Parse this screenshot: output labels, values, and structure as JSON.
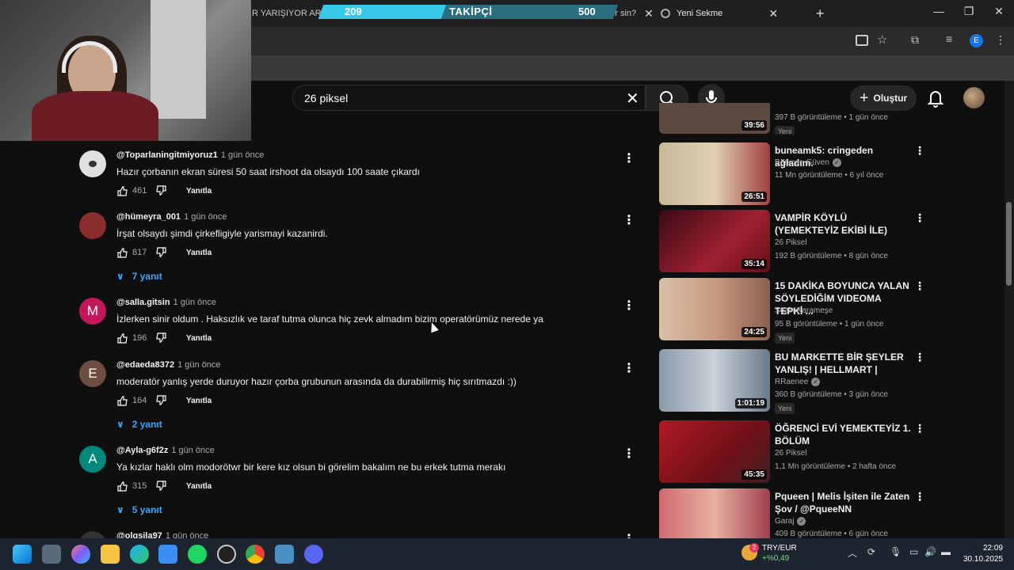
{
  "browser": {
    "tabs": [
      {
        "title": "R YARIŞIYOR AREN",
        "close": "✕"
      },
      {
        "title": "(283) Hangisini Te... Eder sin?",
        "close": "✕"
      },
      {
        "title": "Yeni Sekme",
        "close": "✕"
      }
    ],
    "new_tab": "+",
    "profile_initial": "E"
  },
  "overlay": {
    "follower_current": "209",
    "follower_label": "TAKİPÇİ",
    "follower_goal": "500",
    "follower_progress": 0.418
  },
  "header": {
    "search_query": "26 piksel",
    "create_label": "Oluştur"
  },
  "comments": [
    {
      "author": "@Toparlaningitmiyoruz1",
      "time": "1 gün önce",
      "text": "Hazır çorbanın ekran süresi 50 saat irshoot da olsaydı 100 saate çıkardı",
      "likes": "461",
      "reply": "Yanıtla",
      "avatar": "",
      "avatar_color": "#e0e0e0"
    },
    {
      "author": "@hümeyra_001",
      "time": "1 gün önce",
      "text": "İrşat olsaydı şimdi çirkefligiyle yarismayi kazanirdi.",
      "likes": "817",
      "reply": "Yanıtla",
      "avatar": "",
      "avatar_color": "#8a2d2d",
      "replies": "7 yanıt"
    },
    {
      "author": "@salla.gitsin",
      "time": "1 gün önce",
      "text": "İzlerken sinir oldum . Haksızlık ve taraf tutma olunca hiç zevk almadım bizim operatörümüz nerede ya",
      "likes": "196",
      "reply": "Yanıtla",
      "avatar": "M",
      "avatar_color": "#c2185b"
    },
    {
      "author": "@edaeda8372",
      "time": "1 gün önce",
      "text": "moderatör yanlış yerde duruyor hazır çorba grubunun arasında da durabilirmiş hiç sırıtmazdı :))",
      "likes": "164",
      "reply": "Yanıtla",
      "avatar": "E",
      "avatar_color": "#6d4c41",
      "replies": "2 yanıt"
    },
    {
      "author": "@Ayla-g6f2z",
      "time": "1 gün önce",
      "text": "Ya kızlar haklı olm modorötwr bir kere kız olsun bi görelim bakalım ne bu erkek tutma merakı",
      "likes": "315",
      "reply": "Yanıtla",
      "avatar": "A",
      "avatar_color": "#00897b",
      "replies": "5 yanıt"
    },
    {
      "author": "@olgsila97",
      "time": "1 gün önce",
      "text": "",
      "likes": "",
      "reply": "",
      "avatar": "",
      "avatar_color": "#333"
    }
  ],
  "recommendations": [
    {
      "title": "",
      "channel": "",
      "meta": "397 B görüntüleme • 1 gün önce",
      "duration": "39:56",
      "badge": "Yeni",
      "thumb_color": "#5a4a40"
    },
    {
      "title": "buneamk5: cringeden ağladım.",
      "channel": "Berkcan Güven",
      "meta": "11 Mn görüntüleme • 6 yıl önce",
      "duration": "26:51",
      "thumb_color": "#7a6a55"
    },
    {
      "title": "VAMPİR KÖYLÜ (YEMEKTEYİZ EKİBİ İLE)",
      "channel": "26 Piksel",
      "meta": "192 B görüntüleme • 8 gün önce",
      "duration": "35:14",
      "thumb_color": "#6a1a24"
    },
    {
      "title": "15 DAKİKA BOYUNCA YALAN SÖYLEDİĞİM VIDEOMA TEPKİ ...",
      "channel": "Sezin Karameşe",
      "meta": "95 B görüntüleme • 1 gün önce",
      "duration": "24:25",
      "badge": "Yeni",
      "thumb_color": "#b08878"
    },
    {
      "title": "BU MARKETTE BİR ŞEYLER YANLIŞ! | HELLMART |",
      "channel": "RRaenee",
      "meta": "360 B görüntüleme • 3 gün önce",
      "duration": "1:01:19",
      "badge": "Yeni",
      "thumb_color": "#5a6a7a"
    },
    {
      "title": "ÖĞRENCİ EVİ YEMEKTEYİZ 1. BÖLÜM",
      "channel": "26 Piksel",
      "meta": "1,1 Mn görüntüleme • 2 hafta önce",
      "duration": "45:35",
      "thumb_color": "#8a1a22"
    },
    {
      "title": "Pqueen | Melis İşiten ile Zaten Şov / @PqueeNN",
      "channel": "Garaj",
      "meta": "409 B görüntüleme • 6 gün önce",
      "duration": "",
      "thumb_color": "#b04a5a"
    }
  ],
  "taskbar": {
    "fx_pair": "TRY/EUR",
    "fx_change": "+%0,49",
    "fx_badge": "2",
    "time": "22:09",
    "date": "30.10.2025"
  },
  "icons": [
    "windows-icon",
    "search-icon",
    "copilot-icon",
    "file-explorer-icon",
    "edge-icon",
    "store-icon",
    "spotify-icon",
    "steam-icon",
    "chrome-icon",
    "app-icon",
    "discord-icon"
  ]
}
